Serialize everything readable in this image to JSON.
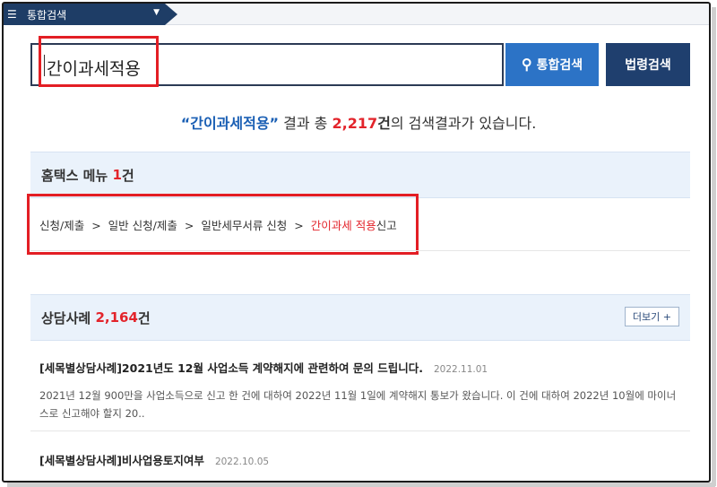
{
  "topbar": {
    "menu_icon": "hamburger-icon",
    "title": "통합검색",
    "caret_icon": "caret-down-icon"
  },
  "search": {
    "value": "간이과세적용",
    "integrated_button": "통합검색",
    "search_icon": "search-icon",
    "law_button": "법령검색"
  },
  "summary": {
    "open_quote": "“",
    "term": "간이과세적용",
    "close_quote": "”",
    "mid": " 결과 총 ",
    "total": "2,217",
    "unit": "건",
    "tail": "의 검색결과가 있습니다."
  },
  "hometax": {
    "title": "홈택스 메뉴",
    "count": "1",
    "unit": "건",
    "path": [
      "신청/제출",
      "일반 신청/제출",
      "일반세무서류 신청"
    ],
    "separator": ">",
    "last_highlight": "간이과세 적용",
    "last_rest": "신고"
  },
  "cases": {
    "title": "상담사례",
    "count": "2,164",
    "unit": "건",
    "more_button": "더보기 +",
    "items": [
      {
        "title": "[세목별상담사례]2021년도 12월 사업소득 계약해지에 관련하여 문의 드립니다.",
        "date": "2022.11.01",
        "body": "2021년 12월 900만을 사업소득으로 신고 한 건에 대하여 2022년 11월 1일에 계약해지 통보가 왔습니다. 이 건에 대하여 2022년 10월에 마이너스로 신고해야 할지 20.."
      },
      {
        "title": "[세목별상담사례]비사업용토지여부",
        "date": "2022.10.05",
        "body": ""
      }
    ]
  },
  "colors": {
    "accent_blue": "#2c73c6",
    "navy": "#1f3f6e",
    "highlight_red": "#e3242b",
    "section_bg": "#eaf2fb"
  }
}
